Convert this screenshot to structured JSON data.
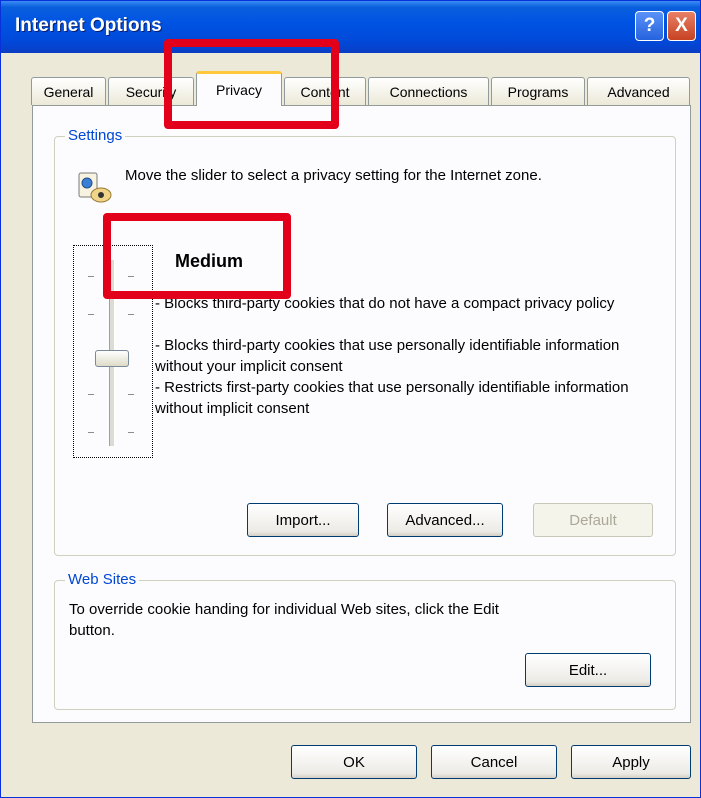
{
  "window": {
    "title": "Internet Options",
    "help_glyph": "?",
    "close_glyph": "X"
  },
  "tabs": [
    {
      "label": "General"
    },
    {
      "label": "Security"
    },
    {
      "label": "Privacy"
    },
    {
      "label": "Content"
    },
    {
      "label": "Connections"
    },
    {
      "label": "Programs"
    },
    {
      "label": "Advanced"
    }
  ],
  "settings": {
    "group_label": "Settings",
    "description": "Move the slider to select a privacy setting for the Internet zone.",
    "level": "Medium",
    "bullets": [
      "- Blocks third-party cookies that do not have a compact privacy policy",
      "- Blocks third-party cookies that use personally identifiable information without your implicit consent",
      "- Restricts first-party cookies that use personally identifiable information without implicit consent"
    ],
    "import_label": "Import...",
    "advanced_label": "Advanced...",
    "default_label": "Default"
  },
  "websites": {
    "group_label": "Web Sites",
    "description": "To override cookie handing for individual Web sites, click the Edit button.",
    "edit_label": "Edit..."
  },
  "footer": {
    "ok_label": "OK",
    "cancel_label": "Cancel",
    "apply_label": "Apply"
  },
  "colors": {
    "title_blue": "#0054e3",
    "group_label_blue": "#0046d5",
    "highlight_red": "#e3001b"
  }
}
